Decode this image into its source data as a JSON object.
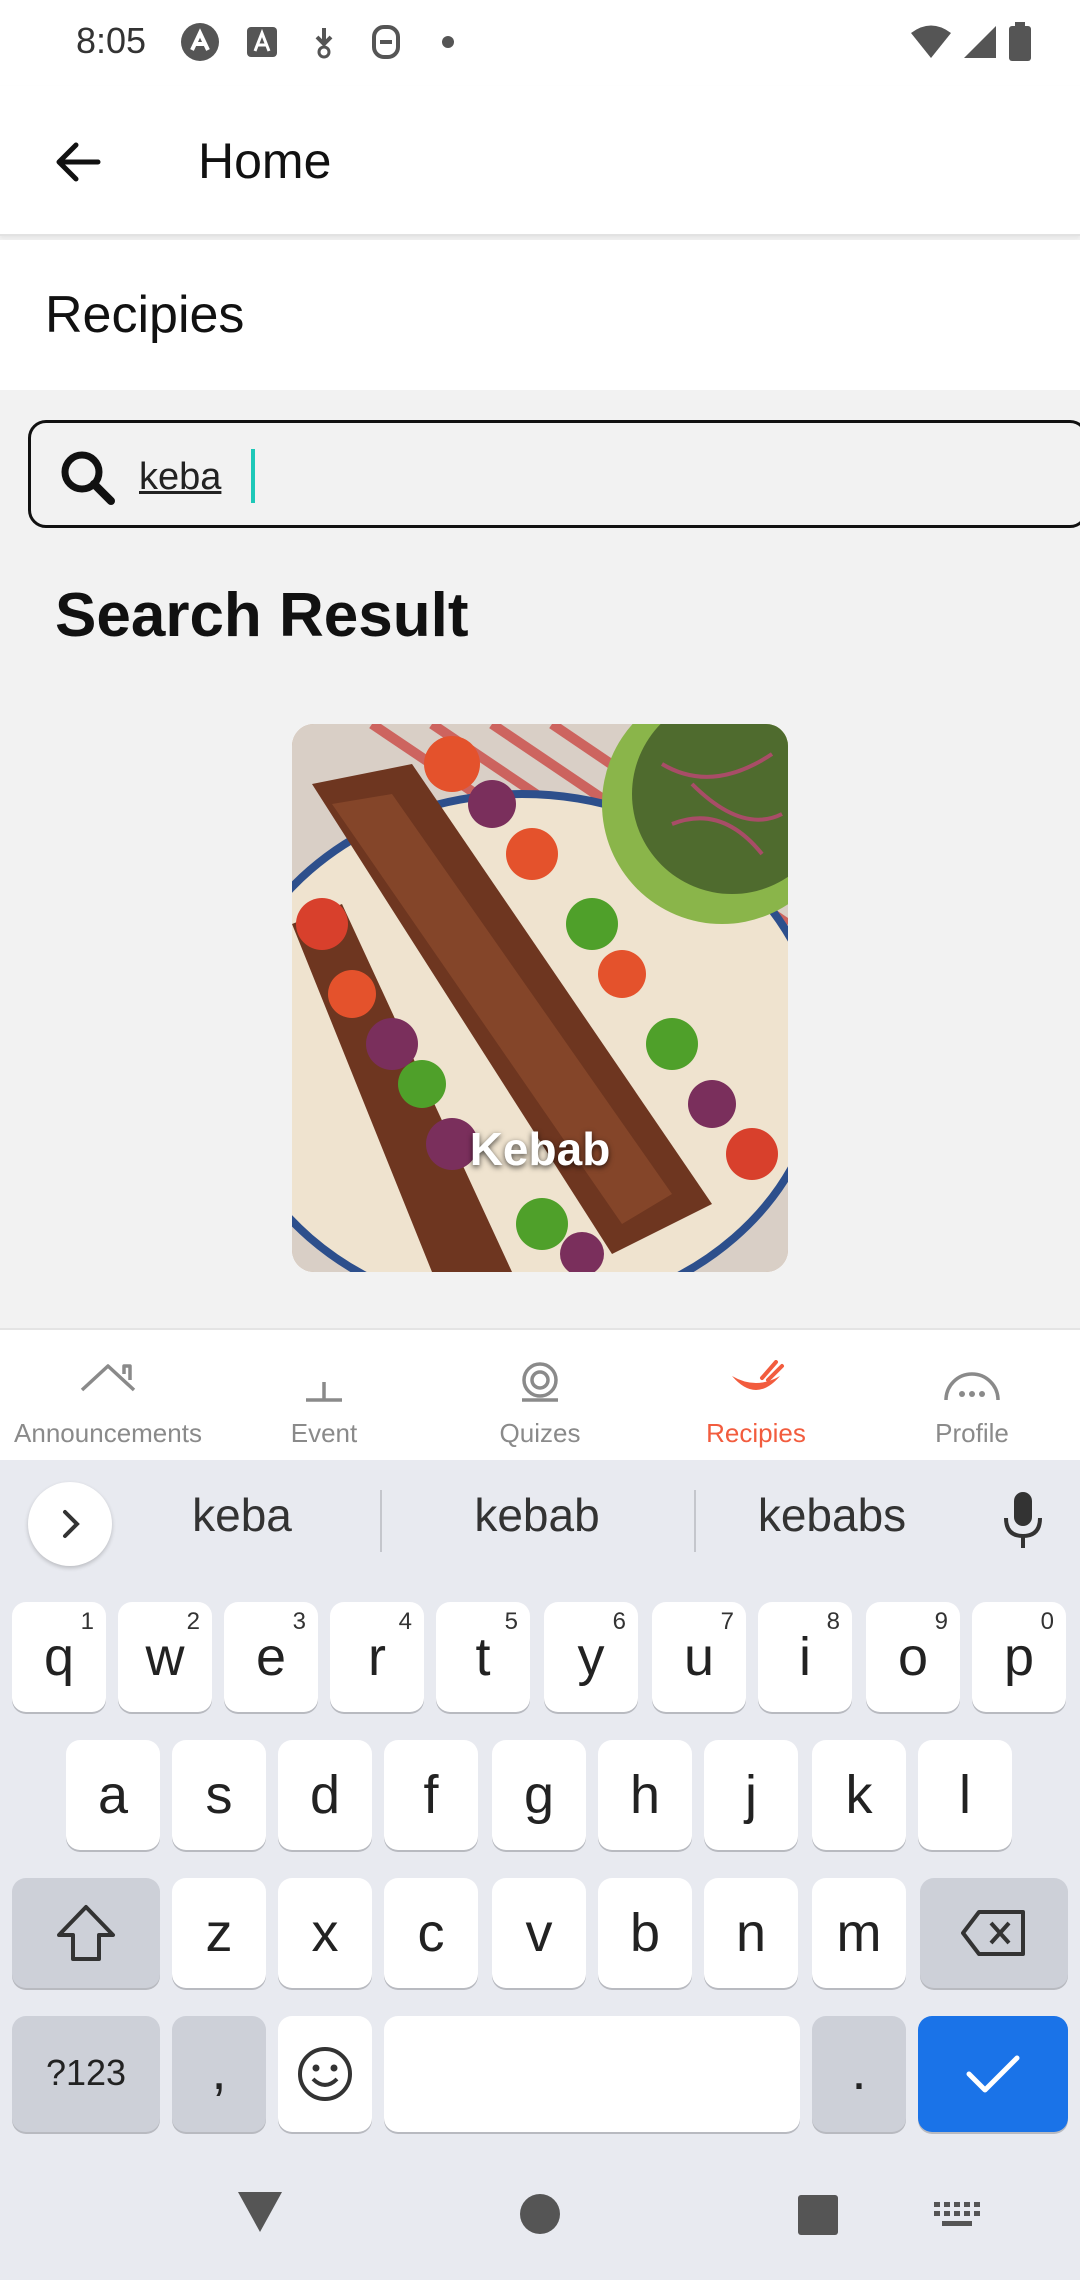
{
  "status_bar": {
    "time": "8:05"
  },
  "app_bar": {
    "title": "Home"
  },
  "section": {
    "title": "Recipies"
  },
  "search": {
    "value": "keba",
    "placeholder": ""
  },
  "results": {
    "heading": "Search Result",
    "items": [
      {
        "name": "Kebab"
      }
    ]
  },
  "bottom_nav": {
    "items": [
      {
        "label": "Announcements",
        "icon": "house-icon",
        "active": false
      },
      {
        "label": "Event",
        "icon": "event-icon",
        "active": false
      },
      {
        "label": "Quizes",
        "icon": "quiz-icon",
        "active": false
      },
      {
        "label": "Recipies",
        "icon": "recipe-icon",
        "active": true
      },
      {
        "label": "Profile",
        "icon": "profile-icon",
        "active": false
      }
    ],
    "active_color": "#f25c3e"
  },
  "keyboard": {
    "suggestions": [
      "keba",
      "kebab",
      "kebabs"
    ],
    "row1": [
      {
        "c": "q",
        "h": "1"
      },
      {
        "c": "w",
        "h": "2"
      },
      {
        "c": "e",
        "h": "3"
      },
      {
        "c": "r",
        "h": "4"
      },
      {
        "c": "t",
        "h": "5"
      },
      {
        "c": "y",
        "h": "6"
      },
      {
        "c": "u",
        "h": "7"
      },
      {
        "c": "i",
        "h": "8"
      },
      {
        "c": "o",
        "h": "9"
      },
      {
        "c": "p",
        "h": "0"
      }
    ],
    "row2": [
      "a",
      "s",
      "d",
      "f",
      "g",
      "h",
      "j",
      "k",
      "l"
    ],
    "row3": [
      "z",
      "x",
      "c",
      "v",
      "b",
      "n",
      "m"
    ],
    "symbols_label": "?123",
    "comma_label": ",",
    "period_label": ".",
    "enter_color": "#1a73e8"
  }
}
